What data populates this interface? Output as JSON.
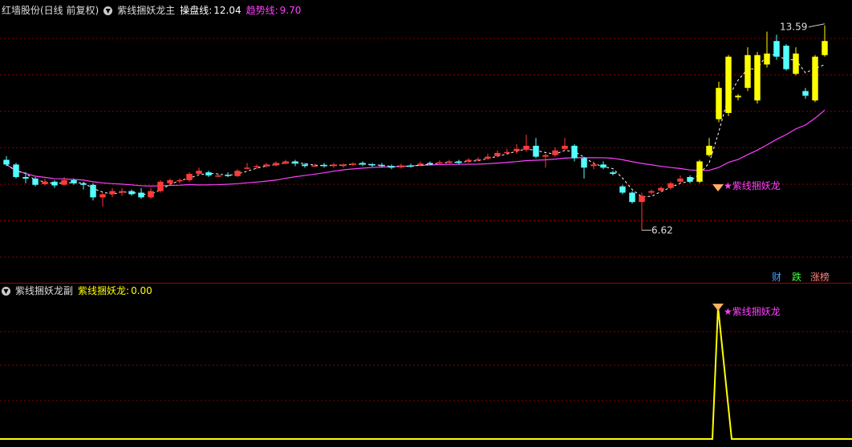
{
  "main_header": {
    "stock": "红墙股份(日线 前复权)",
    "indicator": "紫线捆妖龙主",
    "line1_label": "操盘线:",
    "line1_value": "12.04",
    "line2_label": "趋势线:",
    "line2_value": "9.70"
  },
  "sub_header": {
    "indicator": "紫线捆妖龙副",
    "label": "紫线捆妖龙:",
    "value": "0.00"
  },
  "badges": [
    "财",
    "跌",
    "涨榜"
  ],
  "colors": {
    "up": "#ff3a3a",
    "down": "#54ffff",
    "yellow": "#ffff00",
    "magenta": "#ff40ff",
    "grid": "#8b0000"
  },
  "chart_data": {
    "type": "candlestick",
    "ylim": [
      6.0,
      14.2
    ],
    "max_label": "13.59",
    "min_label": "6.62",
    "signal_label": "★紫线捆妖龙",
    "candles": [
      [
        9.6,
        9.45,
        9.72,
        9.4
      ],
      [
        9.45,
        9.05,
        9.5,
        9.0
      ],
      [
        9.05,
        9.0,
        9.2,
        8.85
      ],
      [
        9.0,
        8.8,
        9.05,
        8.75
      ],
      [
        8.82,
        8.9,
        9.0,
        8.78
      ],
      [
        8.9,
        8.78,
        8.95,
        8.7
      ],
      [
        8.8,
        8.95,
        9.05,
        8.78
      ],
      [
        8.95,
        8.85,
        9.0,
        8.8
      ],
      [
        8.85,
        8.8,
        8.9,
        8.65
      ],
      [
        8.8,
        8.4,
        8.85,
        8.3
      ],
      [
        8.4,
        8.5,
        8.55,
        8.1
      ],
      [
        8.5,
        8.6,
        8.7,
        8.4
      ],
      [
        8.55,
        8.6,
        8.7,
        8.45
      ],
      [
        8.6,
        8.5,
        8.65,
        8.45
      ],
      [
        8.55,
        8.4,
        8.7,
        8.35
      ],
      [
        8.4,
        8.6,
        8.7,
        8.35
      ],
      [
        8.6,
        8.9,
        8.95,
        8.55
      ],
      [
        8.85,
        8.95,
        9.0,
        8.8
      ],
      [
        8.92,
        8.95,
        9.0,
        8.85
      ],
      [
        8.95,
        9.15,
        9.2,
        8.9
      ],
      [
        9.15,
        9.25,
        9.35,
        9.1
      ],
      [
        9.2,
        9.1,
        9.25,
        9.05
      ],
      [
        9.1,
        9.1,
        9.15,
        9.05
      ],
      [
        9.12,
        9.1,
        9.2,
        9.05
      ],
      [
        9.08,
        9.25,
        9.3,
        9.05
      ],
      [
        9.35,
        9.35,
        9.5,
        9.3
      ],
      [
        9.38,
        9.4,
        9.45,
        9.3
      ],
      [
        9.4,
        9.45,
        9.5,
        9.35
      ],
      [
        9.42,
        9.5,
        9.55,
        9.4
      ],
      [
        9.48,
        9.55,
        9.6,
        9.45
      ],
      [
        9.55,
        9.48,
        9.6,
        9.4
      ],
      [
        9.45,
        9.4,
        9.5,
        9.35
      ],
      [
        9.42,
        9.42,
        9.48,
        9.38
      ],
      [
        9.44,
        9.4,
        9.5,
        9.35
      ],
      [
        9.4,
        9.45,
        9.5,
        9.35
      ],
      [
        9.4,
        9.45,
        9.48,
        9.35
      ],
      [
        9.44,
        9.48,
        9.52,
        9.4
      ],
      [
        9.5,
        9.45,
        9.55,
        9.4
      ],
      [
        9.46,
        9.42,
        9.5,
        9.38
      ],
      [
        9.44,
        9.4,
        9.5,
        9.35
      ],
      [
        9.4,
        9.35,
        9.45,
        9.3
      ],
      [
        9.36,
        9.42,
        9.48,
        9.32
      ],
      [
        9.42,
        9.4,
        9.48,
        9.35
      ],
      [
        9.44,
        9.48,
        9.55,
        9.4
      ],
      [
        9.5,
        9.48,
        9.55,
        9.42
      ],
      [
        9.48,
        9.52,
        9.58,
        9.44
      ],
      [
        9.52,
        9.55,
        9.6,
        9.48
      ],
      [
        9.55,
        9.5,
        9.6,
        9.45
      ],
      [
        9.55,
        9.6,
        9.65,
        9.5
      ],
      [
        9.6,
        9.62,
        9.68,
        9.55
      ],
      [
        9.64,
        9.7,
        9.8,
        9.6
      ],
      [
        9.72,
        9.82,
        9.9,
        9.68
      ],
      [
        9.85,
        9.85,
        9.95,
        9.8
      ],
      [
        9.88,
        9.95,
        10.1,
        9.8
      ],
      [
        9.92,
        10.05,
        10.4,
        9.85
      ],
      [
        10.05,
        9.7,
        10.3,
        9.65
      ],
      [
        9.7,
        9.75,
        9.8,
        9.35
      ],
      [
        9.75,
        9.9,
        10.0,
        9.7
      ],
      [
        9.95,
        10.05,
        10.3,
        9.9
      ],
      [
        10.05,
        9.65,
        10.1,
        9.55
      ],
      [
        9.65,
        9.35,
        9.7,
        9.0
      ],
      [
        9.4,
        9.45,
        9.55,
        9.3
      ],
      [
        9.45,
        9.35,
        9.55,
        9.3
      ],
      [
        9.2,
        9.15,
        9.25,
        9.1
      ],
      [
        8.75,
        8.55,
        8.8,
        8.5
      ],
      [
        8.55,
        8.25,
        8.6,
        8.2
      ],
      [
        8.25,
        8.45,
        8.55,
        7.35
      ],
      [
        8.55,
        8.6,
        8.65,
        8.5
      ],
      [
        8.62,
        8.7,
        8.75,
        8.58
      ],
      [
        8.7,
        8.85,
        8.9,
        8.65
      ],
      [
        8.9,
        9.0,
        9.1,
        8.85
      ],
      [
        9.05,
        8.9,
        9.1,
        8.85
      ],
      [
        8.9,
        9.55,
        9.6,
        8.85
      ],
      [
        9.75,
        10.05,
        10.3,
        9.7
      ],
      [
        10.9,
        11.9,
        12.1,
        10.8
      ],
      [
        11.1,
        12.9,
        12.95,
        11.0
      ],
      [
        11.6,
        11.65,
        11.7,
        11.5
      ],
      [
        11.9,
        12.95,
        13.2,
        11.8
      ],
      [
        11.5,
        12.95,
        13.05,
        11.4
      ],
      [
        12.65,
        13.0,
        13.7,
        12.55
      ],
      [
        13.4,
        12.9,
        13.6,
        12.8
      ],
      [
        13.25,
        12.5,
        13.3,
        12.45
      ],
      [
        12.35,
        13.0,
        13.2,
        12.3
      ],
      [
        11.8,
        11.65,
        11.9,
        11.55
      ],
      [
        11.5,
        12.9,
        12.95,
        11.45
      ],
      [
        12.95,
        13.4,
        13.9,
        12.9
      ]
    ],
    "x_signal": 895,
    "signal": {
      "base": 0.0,
      "peak": 1.0
    }
  }
}
